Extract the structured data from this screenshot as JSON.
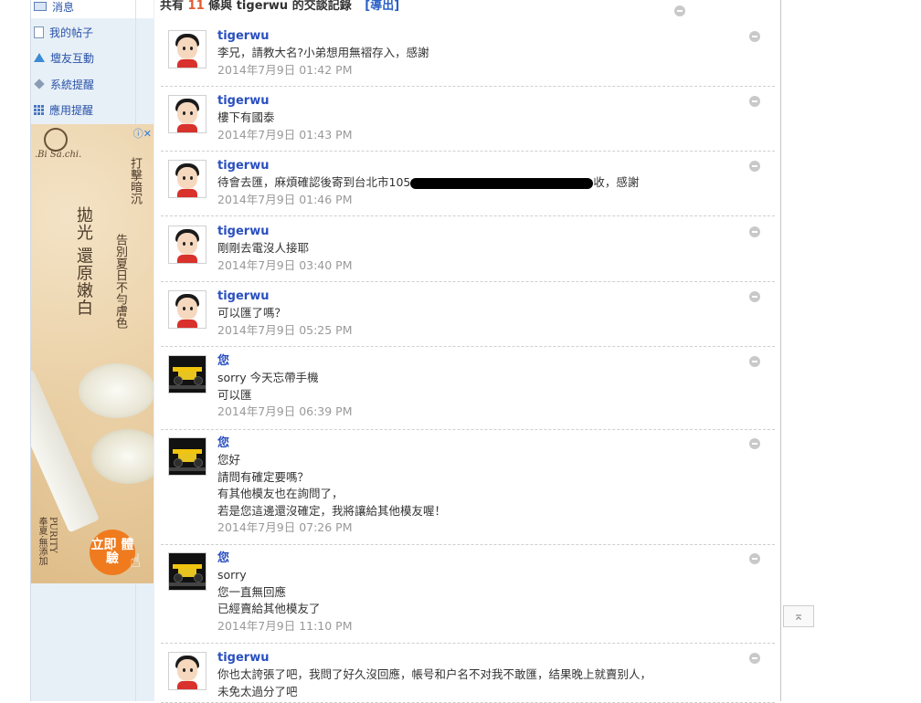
{
  "sidebar": {
    "items": [
      {
        "label": "消息",
        "icon": "mail-icon"
      },
      {
        "label": "我的帖子",
        "icon": "document-icon"
      },
      {
        "label": "壇友互動",
        "icon": "triangle-icon"
      },
      {
        "label": "系統提醒",
        "icon": "diamond-icon"
      },
      {
        "label": "應用提醒",
        "icon": "grid-icon"
      }
    ]
  },
  "ad": {
    "brand": ".Bi Sa.chi.",
    "headline": "拋光 還原嫩白",
    "copy1": "打擊暗沉",
    "copy2": "告別夏日不勻膚色",
    "side_text": "PURITY",
    "side_text2": "奉夏‧無添加",
    "cta": "立即 體驗",
    "close": "ⓘ✕"
  },
  "summary": {
    "prefix": "共有",
    "count": "11",
    "middle": "條與",
    "partner": "tigerwu",
    "suffix": "的交談記錄",
    "export_label": "[導出]"
  },
  "messages": [
    {
      "author": "tigerwu",
      "avatar": "boy-avatar",
      "lines": [
        "李兄，請教大名?小弟想用無褶存入，感謝"
      ],
      "time": "2014年7月9日 01:42 PM"
    },
    {
      "author": "tigerwu",
      "avatar": "boy-avatar",
      "lines": [
        "樓下有國泰"
      ],
      "time": "2014年7月9日 01:43 PM"
    },
    {
      "author": "tigerwu",
      "avatar": "boy-avatar",
      "lines": [
        "待會去匯，麻煩確認後寄到台北市105",
        "收，感謝"
      ],
      "time": "2014年7月9日 01:46 PM"
    },
    {
      "author": "tigerwu",
      "avatar": "boy-avatar",
      "lines": [
        "剛剛去電沒人接耶"
      ],
      "time": "2014年7月9日 03:40 PM"
    },
    {
      "author": "tigerwu",
      "avatar": "boy-avatar",
      "lines": [
        "可以匯了嗎？"
      ],
      "time": "2014年7月9日 05:25 PM"
    },
    {
      "author": "您",
      "avatar": "race-car-avatar",
      "lines": [
        "sorry 今天忘帶手機",
        "可以匯"
      ],
      "time": "2014年7月9日 06:39 PM"
    },
    {
      "author": "您",
      "avatar": "race-car-avatar",
      "lines": [
        "您好",
        "請問有確定要嗎？",
        "有其他模友也在詢問了，",
        "若是您這邊還沒確定，我將讓給其他模友喔！"
      ],
      "time": "2014年7月9日 07:26 PM"
    },
    {
      "author": "您",
      "avatar": "race-car-avatar",
      "lines": [
        "sorry",
        "您一直無回應",
        "已經賣給其他模友了"
      ],
      "time": "2014年7月9日 11:10 PM"
    },
    {
      "author": "tigerwu",
      "avatar": "boy-avatar",
      "lines": [
        "你也太誇張了吧，我問了好久沒回應，帳号和户名不对我不敢匯，结果晚上就賣别人，",
        "未免太過分了吧"
      ],
      "time": ""
    }
  ],
  "back_to_top": "⌅"
}
